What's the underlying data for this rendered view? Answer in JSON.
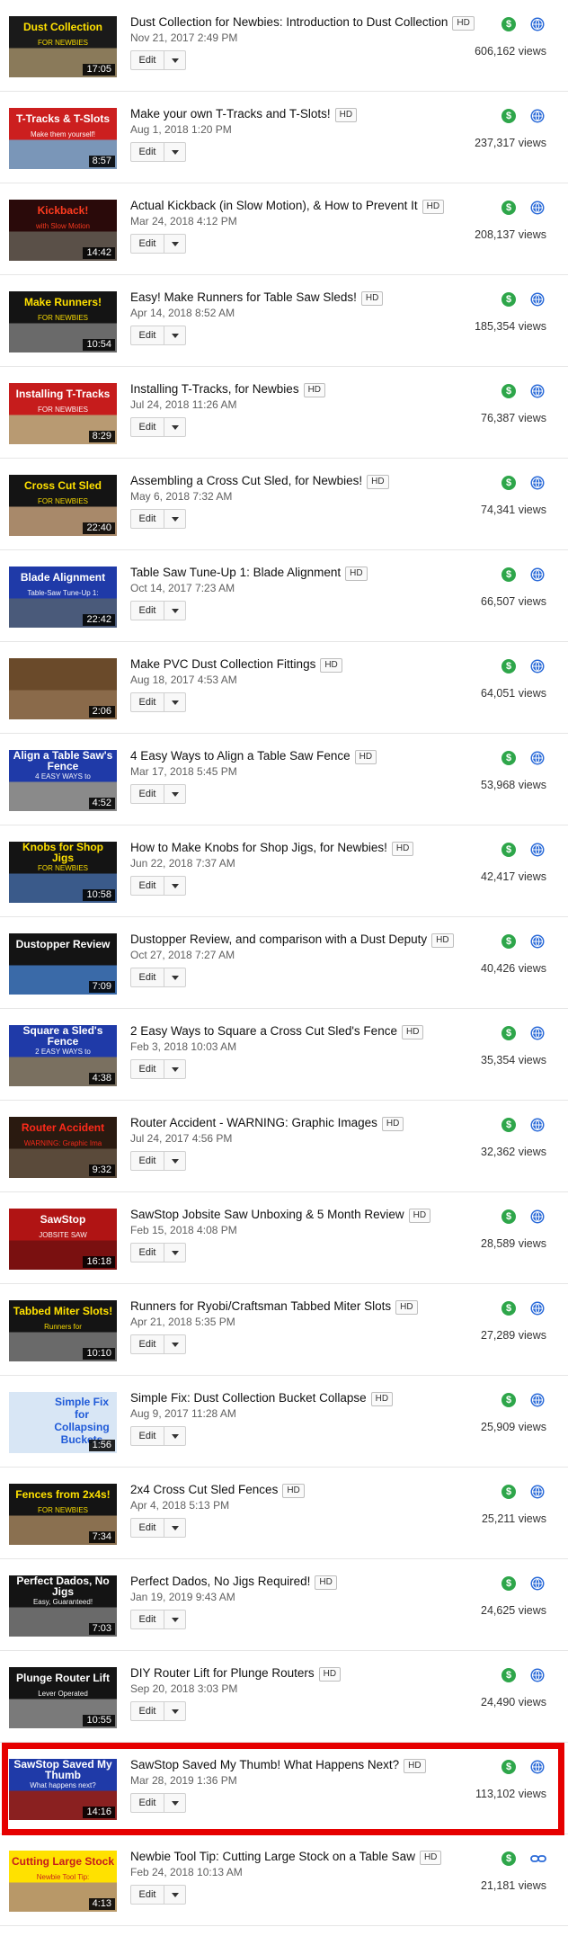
{
  "videos": [
    {
      "title": "Dust Collection for Newbies: Introduction to Dust Collection",
      "hd_badge": "HD",
      "date": "Nov 21, 2017 2:49 PM",
      "edit_label": "Edit",
      "views": "606,162 views",
      "duration": "17:05",
      "thumb_text": "Dust Collection",
      "thumb_sub": "FOR NEWBIES",
      "thumb_bg": "#8a7a5a",
      "thumb_band": "#1a1a1a",
      "thumb_fg": "#ffe100",
      "visibility_icon": "globe-icon",
      "monetization_icon": "dollar-icon",
      "highlighted": false
    },
    {
      "title": "Make your own T-Tracks and T-Slots!",
      "hd_badge": "HD",
      "date": "Aug 1, 2018 1:20 PM",
      "edit_label": "Edit",
      "views": "237,317 views",
      "duration": "8:57",
      "thumb_text": "T-Tracks & T-Slots",
      "thumb_sub": "Make them yourself!",
      "thumb_bg": "#7a96b8",
      "thumb_band": "#cc1f1f",
      "thumb_fg": "#ffffff",
      "visibility_icon": "globe-icon",
      "monetization_icon": "dollar-icon",
      "highlighted": false
    },
    {
      "title": "Actual Kickback (in Slow Motion), & How to Prevent It",
      "hd_badge": "HD",
      "date": "Mar 24, 2018 4:12 PM",
      "edit_label": "Edit",
      "views": "208,137 views",
      "duration": "14:42",
      "thumb_text": "Kickback!",
      "thumb_sub": "with Slow Motion",
      "thumb_bg": "#5a5048",
      "thumb_band": "#2a0a0a",
      "thumb_fg": "#ff3b1f",
      "visibility_icon": "globe-icon",
      "monetization_icon": "dollar-icon",
      "highlighted": false
    },
    {
      "title": "Easy! Make Runners for Table Saw Sleds!",
      "hd_badge": "HD",
      "date": "Apr 14, 2018 8:52 AM",
      "edit_label": "Edit",
      "views": "185,354 views",
      "duration": "10:54",
      "thumb_text": "Make Runners!",
      "thumb_sub": "FOR NEWBIES",
      "thumb_bg": "#6a6a6a",
      "thumb_band": "#141414",
      "thumb_fg": "#ffe100",
      "visibility_icon": "globe-icon",
      "monetization_icon": "dollar-icon",
      "highlighted": false
    },
    {
      "title": "Installing T-Tracks, for Newbies",
      "hd_badge": "HD",
      "date": "Jul 24, 2018 11:26 AM",
      "edit_label": "Edit",
      "views": "76,387 views",
      "duration": "8:29",
      "thumb_text": "Installing T-Tracks",
      "thumb_sub": "FOR NEWBIES",
      "thumb_bg": "#b89a72",
      "thumb_band": "#c61c1c",
      "thumb_fg": "#ffffff",
      "visibility_icon": "globe-icon",
      "monetization_icon": "dollar-icon",
      "highlighted": false
    },
    {
      "title": "Assembling a Cross Cut Sled, for Newbies!",
      "hd_badge": "HD",
      "date": "May 6, 2018 7:32 AM",
      "edit_label": "Edit",
      "views": "74,341 views",
      "duration": "22:40",
      "thumb_text": "Cross Cut Sled",
      "thumb_sub": "FOR NEWBIES",
      "thumb_bg": "#a8896a",
      "thumb_band": "#141414",
      "thumb_fg": "#ffe100",
      "visibility_icon": "globe-icon",
      "monetization_icon": "dollar-icon",
      "highlighted": false
    },
    {
      "title": "Table Saw Tune-Up 1: Blade Alignment",
      "hd_badge": "HD",
      "date": "Oct 14, 2017 7:23 AM",
      "edit_label": "Edit",
      "views": "66,507 views",
      "duration": "22:42",
      "thumb_text": "Blade Alignment",
      "thumb_sub": "Table-Saw Tune-Up 1:",
      "thumb_bg": "#4a5a7a",
      "thumb_band": "#1f3aa8",
      "thumb_fg": "#ffffff",
      "visibility_icon": "globe-icon",
      "monetization_icon": "dollar-icon",
      "highlighted": false
    },
    {
      "title": "Make PVC Dust Collection Fittings",
      "hd_badge": "HD",
      "date": "Aug 18, 2017 4:53 AM",
      "edit_label": "Edit",
      "views": "64,051 views",
      "duration": "2:06",
      "thumb_text": "",
      "thumb_sub": "",
      "thumb_bg": "#8a6a4a",
      "thumb_band": "#6a4a2a",
      "thumb_fg": "#ffffff",
      "visibility_icon": "globe-icon",
      "monetization_icon": "dollar-icon",
      "highlighted": false
    },
    {
      "title": "4 Easy Ways to Align a Table Saw Fence",
      "hd_badge": "HD",
      "date": "Mar 17, 2018 5:45 PM",
      "edit_label": "Edit",
      "views": "53,968 views",
      "duration": "4:52",
      "thumb_text": "Align a Table Saw's Fence",
      "thumb_sub": "4 EASY WAYS to",
      "thumb_bg": "#8a8a8a",
      "thumb_band": "#1f3aa8",
      "thumb_fg": "#ffffff",
      "visibility_icon": "globe-icon",
      "monetization_icon": "dollar-icon",
      "highlighted": false
    },
    {
      "title": "How to Make Knobs for Shop Jigs, for Newbies!",
      "hd_badge": "HD",
      "date": "Jun 22, 2018 7:37 AM",
      "edit_label": "Edit",
      "views": "42,417 views",
      "duration": "10:58",
      "thumb_text": "Knobs for Shop Jigs",
      "thumb_sub": "FOR NEWBIES",
      "thumb_bg": "#3a5a8a",
      "thumb_band": "#141414",
      "thumb_fg": "#ffe100",
      "visibility_icon": "globe-icon",
      "monetization_icon": "dollar-icon",
      "highlighted": false
    },
    {
      "title": "Dustopper Review, and comparison with a Dust Deputy",
      "hd_badge": "HD",
      "date": "Oct 27, 2018 7:27 AM",
      "edit_label": "Edit",
      "views": "40,426 views",
      "duration": "7:09",
      "thumb_text": "Dustopper Review",
      "thumb_sub": "",
      "thumb_bg": "#3a6aa8",
      "thumb_band": "#141414",
      "thumb_fg": "#ffffff",
      "visibility_icon": "globe-icon",
      "monetization_icon": "dollar-icon",
      "highlighted": false
    },
    {
      "title": "2 Easy Ways to Square a Cross Cut Sled's Fence",
      "hd_badge": "HD",
      "date": "Feb 3, 2018 10:03 AM",
      "edit_label": "Edit",
      "views": "35,354 views",
      "duration": "4:38",
      "thumb_text": "Square a Sled's Fence",
      "thumb_sub": "2 EASY WAYS to",
      "thumb_bg": "#7a7060",
      "thumb_band": "#1f3aa8",
      "thumb_fg": "#ffffff",
      "visibility_icon": "globe-icon",
      "monetization_icon": "dollar-icon",
      "highlighted": false
    },
    {
      "title": "Router Accident - WARNING: Graphic Images",
      "hd_badge": "HD",
      "date": "Jul 24, 2017 4:56 PM",
      "edit_label": "Edit",
      "views": "32,362 views",
      "duration": "9:32",
      "thumb_text": "Router Accident",
      "thumb_sub": "WARNING: Graphic Ima",
      "thumb_bg": "#5a4a3a",
      "thumb_band": "#2a1a10",
      "thumb_fg": "#ff2a1a",
      "visibility_icon": "globe-icon",
      "monetization_icon": "dollar-icon",
      "highlighted": false
    },
    {
      "title": "SawStop Jobsite Saw Unboxing & 5 Month Review",
      "hd_badge": "HD",
      "date": "Feb 15, 2018 4:08 PM",
      "edit_label": "Edit",
      "views": "28,589 views",
      "duration": "16:18",
      "thumb_text": "SawStop",
      "thumb_sub": "JOBSITE SAW",
      "thumb_bg": "#7a1010",
      "thumb_band": "#b01414",
      "thumb_fg": "#ffffff",
      "visibility_icon": "globe-icon",
      "monetization_icon": "dollar-icon",
      "highlighted": false
    },
    {
      "title": "Runners for Ryobi/Craftsman Tabbed Miter Slots",
      "hd_badge": "HD",
      "date": "Apr 21, 2018 5:35 PM",
      "edit_label": "Edit",
      "views": "27,289 views",
      "duration": "10:10",
      "thumb_text": "Tabbed Miter Slots!",
      "thumb_sub": "Runners for",
      "thumb_bg": "#6a6a6a",
      "thumb_band": "#141414",
      "thumb_fg": "#ffe100",
      "visibility_icon": "globe-icon",
      "monetization_icon": "dollar-icon",
      "highlighted": false
    },
    {
      "title": "Simple Fix: Dust Collection Bucket Collapse",
      "hd_badge": "HD",
      "date": "Aug 9, 2017 11:28 AM",
      "edit_label": "Edit",
      "views": "25,909 views",
      "duration": "1:56",
      "thumb_text": "Simple Fix for Collapsing Buckets",
      "thumb_sub": "",
      "thumb_bg": "#d8e6f5",
      "thumb_band": "#d8e6f5",
      "thumb_fg": "#1f5ad8",
      "visibility_icon": "globe-icon",
      "monetization_icon": "dollar-icon",
      "highlighted": false
    },
    {
      "title": "2x4 Cross Cut Sled Fences",
      "hd_badge": "HD",
      "date": "Apr 4, 2018 5:13 PM",
      "edit_label": "Edit",
      "views": "25,211 views",
      "duration": "7:34",
      "thumb_text": "Fences from 2x4s!",
      "thumb_sub": "FOR NEWBIES",
      "thumb_bg": "#8a7050",
      "thumb_band": "#141414",
      "thumb_fg": "#ffe100",
      "visibility_icon": "globe-icon",
      "monetization_icon": "dollar-icon",
      "highlighted": false
    },
    {
      "title": "Perfect Dados, No Jigs Required!",
      "hd_badge": "HD",
      "date": "Jan 19, 2019 9:43 AM",
      "edit_label": "Edit",
      "views": "24,625 views",
      "duration": "7:03",
      "thumb_text": "Perfect Dados, No Jigs",
      "thumb_sub": "Easy, Guaranteed!",
      "thumb_bg": "#6a6a6a",
      "thumb_band": "#141414",
      "thumb_fg": "#ffffff",
      "visibility_icon": "globe-icon",
      "monetization_icon": "dollar-icon",
      "highlighted": false
    },
    {
      "title": "DIY Router Lift for Plunge Routers",
      "hd_badge": "HD",
      "date": "Sep 20, 2018 3:03 PM",
      "edit_label": "Edit",
      "views": "24,490 views",
      "duration": "10:55",
      "thumb_text": "Plunge Router Lift",
      "thumb_sub": "Lever Operated",
      "thumb_bg": "#7a7a7a",
      "thumb_band": "#141414",
      "thumb_fg": "#ffffff",
      "visibility_icon": "globe-icon",
      "monetization_icon": "dollar-icon",
      "highlighted": false
    },
    {
      "title": "SawStop Saved My Thumb! What Happens Next?",
      "hd_badge": "HD",
      "date": "Mar 28, 2019 1:36 PM",
      "edit_label": "Edit",
      "views": "113,102 views",
      "duration": "14:16",
      "thumb_text": "SawStop Saved My Thumb",
      "thumb_sub": "What happens next?",
      "thumb_bg": "#8a2020",
      "thumb_band": "#1f3aa8",
      "thumb_fg": "#ffffff",
      "visibility_icon": "globe-icon",
      "monetization_icon": "dollar-icon",
      "highlighted": true
    },
    {
      "title": "Newbie Tool Tip: Cutting Large Stock on a Table Saw",
      "hd_badge": "HD",
      "date": "Feb 24, 2018 10:13 AM",
      "edit_label": "Edit",
      "views": "21,181 views",
      "duration": "4:13",
      "thumb_text": "Cutting Large Stock",
      "thumb_sub": "Newbie Tool Tip:",
      "thumb_bg": "#b89868",
      "thumb_band": "#ffe100",
      "thumb_fg": "#c61c1c",
      "visibility_icon": "link-icon",
      "monetization_icon": "dollar-icon",
      "highlighted": false
    }
  ]
}
